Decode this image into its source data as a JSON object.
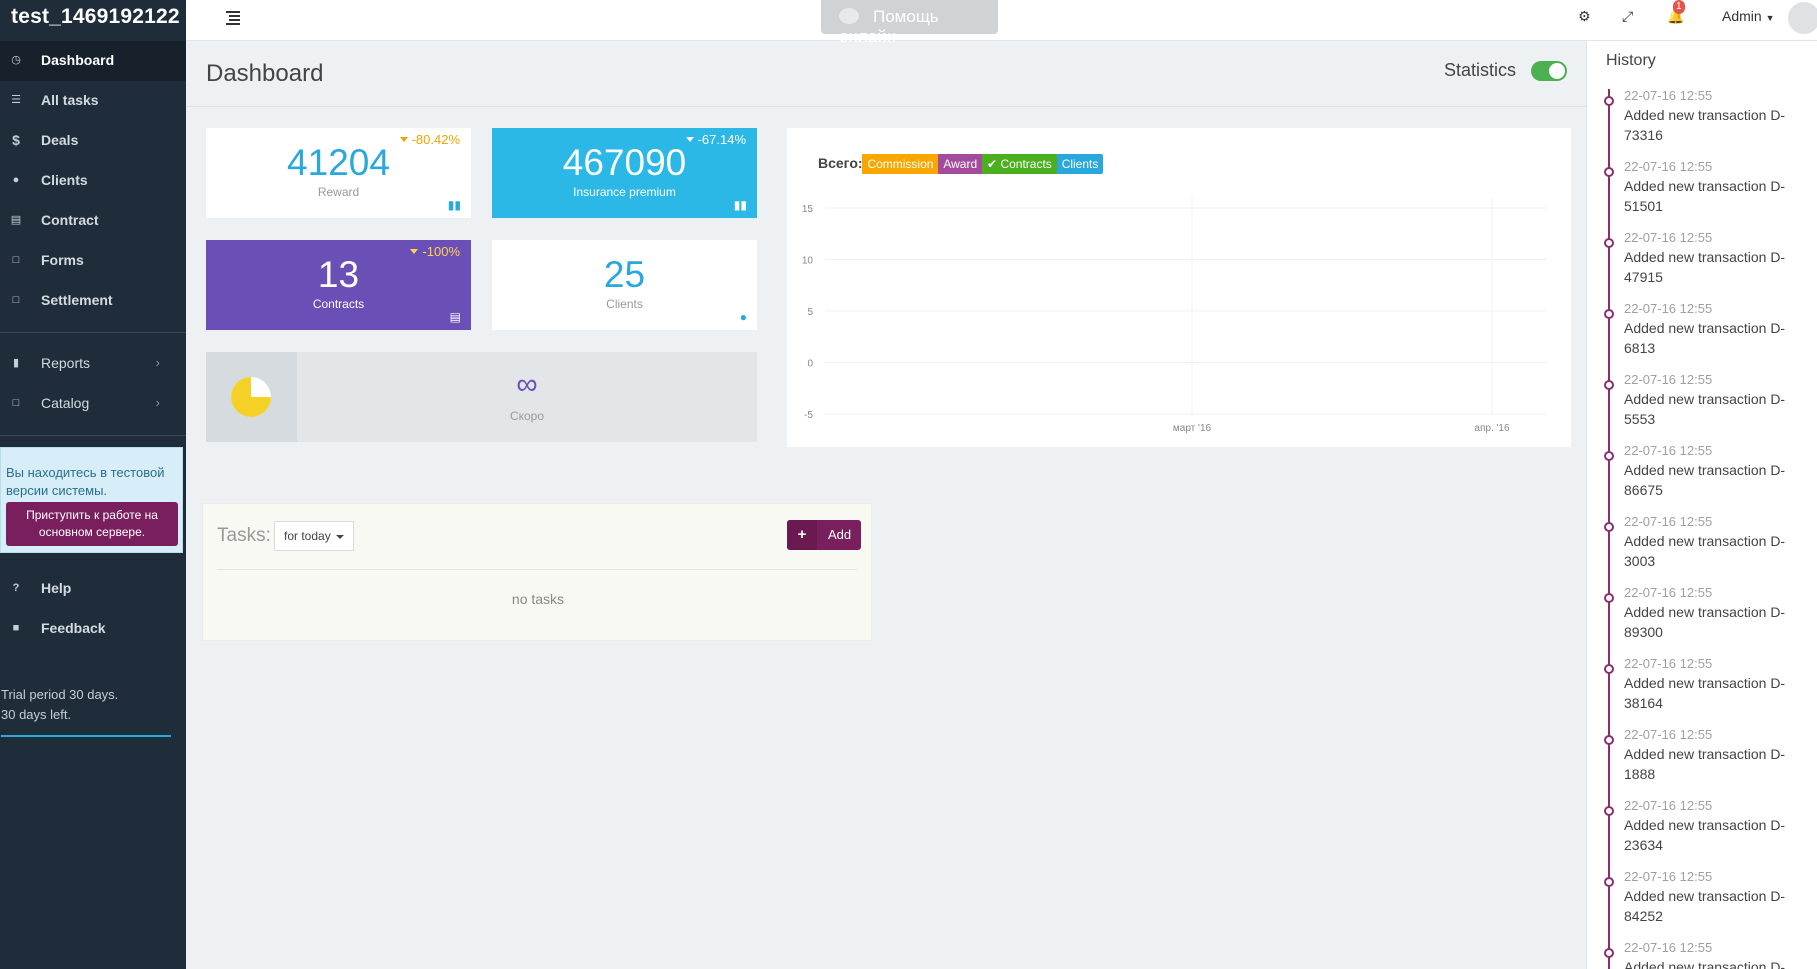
{
  "brand": "test_1469192122",
  "topbar": {
    "help_online": "Помощь онлайн",
    "notifications": "1",
    "user": "Admin"
  },
  "sidebar": {
    "items": [
      {
        "label": "Dashboard",
        "icon": "dashboard-icon"
      },
      {
        "label": "All tasks",
        "icon": "tasks-icon"
      },
      {
        "label": "Deals",
        "icon": "dollar-icon"
      },
      {
        "label": "Clients",
        "icon": "user-icon"
      },
      {
        "label": "Contract",
        "icon": "briefcase-icon"
      },
      {
        "label": "Forms",
        "icon": "file-icon"
      },
      {
        "label": "Settlement",
        "icon": "file-icon"
      }
    ],
    "group2": [
      {
        "label": "Reports",
        "icon": "bar-chart-icon"
      },
      {
        "label": "Catalog",
        "icon": "file-icon"
      }
    ],
    "test_notice": "Вы находитесь в тестовой версии системы.",
    "test_button": "Приступить к работе на основном сервере.",
    "help": "Help",
    "feedback": "Feedback",
    "trial_line1": "Trial period 30 days.",
    "trial_line2": "30 days left."
  },
  "page": {
    "title": "Dashboard",
    "statistics_label": "Statistics",
    "statistics_on": true
  },
  "cards": {
    "reward": {
      "value": "41204",
      "label": "Reward",
      "trend": "-80.42%"
    },
    "insurance": {
      "value": "467090",
      "label": "Insurance premium",
      "trend": "-67.14%"
    },
    "contracts": {
      "value": "13",
      "label": "Contracts",
      "trend": "-100%"
    },
    "clients": {
      "value": "25",
      "label": "Clients"
    },
    "soon": {
      "symbol": "∞",
      "label": "Скоро",
      "pie_fraction": 0.75
    }
  },
  "colors": {
    "commission": "#f7a700",
    "award": "#a44c9c",
    "contracts": "#4caf1f",
    "clients": "#29a8dc"
  },
  "chart_data": {
    "type": "line",
    "total_label": "Всего:",
    "legend": [
      "Commission",
      "Award",
      "Contracts",
      "Clients"
    ],
    "active_legend": "Contracts",
    "x_ticks": [
      "март '16",
      "апр. '16"
    ],
    "y_ticks": [
      15,
      10,
      5,
      0,
      -5
    ],
    "ylim": [
      -5,
      15
    ],
    "grid": true,
    "series": []
  },
  "tasks": {
    "title": "Tasks:",
    "filter": "for today",
    "add_label": "Add",
    "empty": "no tasks"
  },
  "history": {
    "title": "History",
    "items": [
      {
        "time": "22-07-16 12:55",
        "text": "Added new transaction D-73316"
      },
      {
        "time": "22-07-16 12:55",
        "text": "Added new transaction D-51501"
      },
      {
        "time": "22-07-16 12:55",
        "text": "Added new transaction D-47915"
      },
      {
        "time": "22-07-16 12:55",
        "text": "Added new transaction D-6813"
      },
      {
        "time": "22-07-16 12:55",
        "text": "Added new transaction D-5553"
      },
      {
        "time": "22-07-16 12:55",
        "text": "Added new transaction D-86675"
      },
      {
        "time": "22-07-16 12:55",
        "text": "Added new transaction D-3003"
      },
      {
        "time": "22-07-16 12:55",
        "text": "Added new transaction D-89300"
      },
      {
        "time": "22-07-16 12:55",
        "text": "Added new transaction D-38164"
      },
      {
        "time": "22-07-16 12:55",
        "text": "Added new transaction D-1888"
      },
      {
        "time": "22-07-16 12:55",
        "text": "Added new transaction D-23634"
      },
      {
        "time": "22-07-16 12:55",
        "text": "Added new transaction D-84252"
      },
      {
        "time": "22-07-16 12:55",
        "text": "Added new transaction D-"
      }
    ]
  }
}
